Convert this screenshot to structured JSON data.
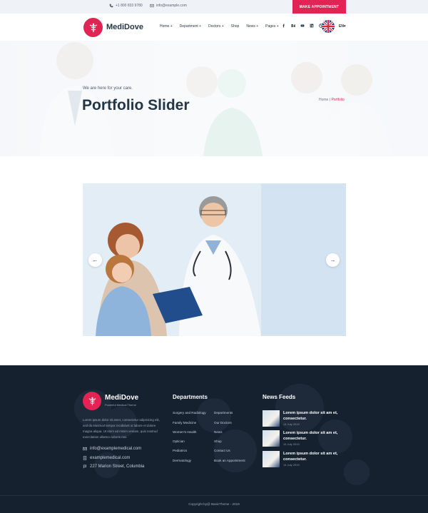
{
  "topbar": {
    "phone": "+1 800 833 9780",
    "email": "info@example.com",
    "appointment_label": "MAKE APPOINTMENT"
  },
  "header": {
    "brand": "MediDove",
    "nav": [
      "Home +",
      "Department +",
      "Doctors +",
      "Shop",
      "News +",
      "Pages +"
    ],
    "social_icons": [
      "facebook-icon",
      "behance-icon",
      "youtube-icon",
      "linkedin-icon",
      "dribbble-icon"
    ],
    "lang": "EN▾"
  },
  "hero": {
    "subtitle": "We are here for your care.",
    "title": "Portfolio Slider",
    "breadcrumb_home": "Home",
    "breadcrumb_sep": "|",
    "breadcrumb_current": "Portfolio"
  },
  "slider": {
    "prev_label": "←",
    "next_label": "→"
  },
  "footer": {
    "brand": "MediDove",
    "tagline": "Powerful Medical Theme",
    "about": "Lorem ipsum dolor sit amet, consectetur adipisicing elit, sed do eiusmod tempor incididunt ut labore et dolore magna aliqua. Ut enim ad minim veniam, quis nostrud exercitation ullamco laboris nisi.",
    "email": "info@examplemedical.com",
    "website": "examplemedical.com",
    "address": "227 Marion Street, Columbia",
    "departments_heading": "Departments",
    "departments_col1": [
      "Surgery and Radiology",
      "Family Medicine",
      "Women's Health",
      "Optician",
      "Pediatrics",
      "Dermatology"
    ],
    "departments_col2": [
      "Departments",
      "Our Doctors",
      "News",
      "Shop",
      "Contact Us",
      "Book an Appointment"
    ],
    "news_heading": "News Feeds",
    "news": [
      {
        "title": "Lorem ipsum dolor sit am et, consectetur.",
        "date": "14 July 2019"
      },
      {
        "title": "Lorem ipsum dolor sit am et, consectetur.",
        "date": "14 July 2019"
      },
      {
        "title": "Lorem ipsum dolor sit am et, consectetur.",
        "date": "14 July 2019"
      }
    ],
    "copyright": "Copyright by@ BasicTheme - 2019"
  },
  "colors": {
    "accent": "#e12454",
    "navy": "#223645",
    "footer_bg": "#162130"
  }
}
